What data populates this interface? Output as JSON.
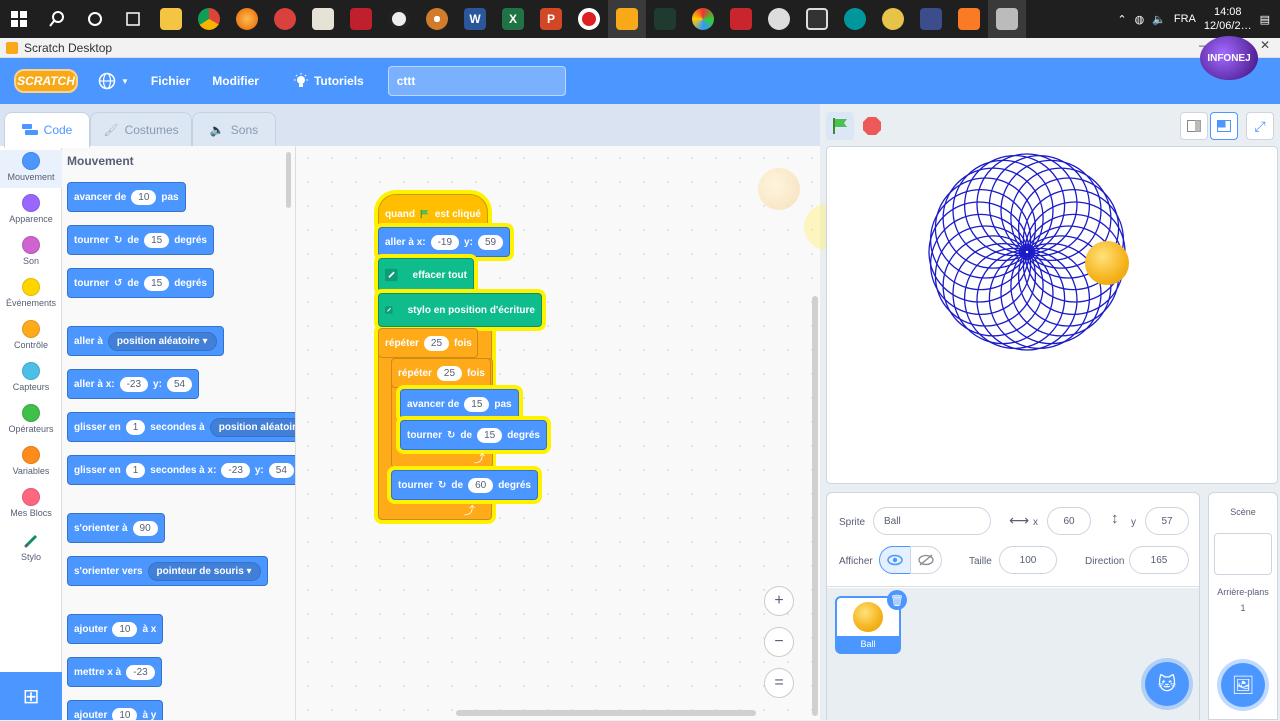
{
  "taskbar": {
    "apps": [
      "windows-start",
      "search",
      "cortana",
      "task-view",
      "file-explorer",
      "chrome",
      "firefox",
      "app-red",
      "app-person",
      "app-download",
      "app-dark",
      "app-media",
      "word",
      "excel",
      "powerpoint",
      "record",
      "scratch",
      "pycharm",
      "app-color",
      "acrobat",
      "app-panda",
      "clapper",
      "arduino",
      "app-infinity",
      "app-dev",
      "xampp",
      "app-video"
    ],
    "lang": "FRA",
    "time": "14:08",
    "date": "12/06/2…"
  },
  "window": {
    "title": "Scratch Desktop",
    "badge": "INFONEJ"
  },
  "menubar": {
    "logo": "SCRATCH",
    "file": "Fichier",
    "edit": "Modifier",
    "tutorials": "Tutoriels",
    "project_title": "cttt"
  },
  "tabs": {
    "code": "Code",
    "costumes": "Costumes",
    "sounds": "Sons"
  },
  "categories": [
    {
      "label": "Mouvement",
      "color": "#4c97ff"
    },
    {
      "label": "Apparence",
      "color": "#9966ff"
    },
    {
      "label": "Son",
      "color": "#cf63cf"
    },
    {
      "label": "Événements",
      "color": "#ffd500"
    },
    {
      "label": "Contrôle",
      "color": "#ffab19"
    },
    {
      "label": "Capteurs",
      "color": "#4cbfe6"
    },
    {
      "label": "Opérateurs",
      "color": "#40bf4a"
    },
    {
      "label": "Variables",
      "color": "#ff8c1a"
    },
    {
      "label": "Mes Blocs",
      "color": "#ff6680"
    },
    {
      "label": "Stylo",
      "color": "#0fbd8c"
    }
  ],
  "palette": {
    "title": "Mouvement",
    "move": {
      "a": "avancer de",
      "v": "10",
      "b": "pas"
    },
    "turn_right": {
      "a": "tourner",
      "b": "de",
      "v": "15",
      "c": "degrés"
    },
    "turn_left": {
      "a": "tourner",
      "b": "de",
      "v": "15",
      "c": "degrés"
    },
    "goto": {
      "a": "aller à",
      "d": "position aléatoire"
    },
    "goto_xy": {
      "a": "aller à x:",
      "x": "-23",
      "b": "y:",
      "y": "54"
    },
    "glide": {
      "a": "glisser en",
      "v": "1",
      "b": "secondes à",
      "d": "position aléatoire"
    },
    "glide_xy": {
      "a": "glisser en",
      "v": "1",
      "b": "secondes à x:",
      "x": "-23",
      "c": "y:",
      "y": "54"
    },
    "point_dir": {
      "a": "s'orienter à",
      "v": "90"
    },
    "point_towards": {
      "a": "s'orienter vers",
      "d": "pointeur de souris"
    },
    "change_x": {
      "a": "ajouter",
      "v": "10",
      "b": "à x"
    },
    "set_x": {
      "a": "mettre x à",
      "v": "-23"
    },
    "change_y": {
      "a": "ajouter",
      "v": "10",
      "b": "à y"
    }
  },
  "script": {
    "hat": {
      "a": "quand",
      "b": "est cliqué"
    },
    "goto": {
      "a": "aller à x:",
      "x": "-19",
      "b": "y:",
      "y": "59"
    },
    "clear": "effacer tout",
    "pen_down": "stylo en position d'écriture",
    "repeat_outer": {
      "a": "répéter",
      "v": "25",
      "b": "fois"
    },
    "repeat_inner": {
      "a": "répéter",
      "v": "25",
      "b": "fois"
    },
    "move": {
      "a": "avancer de",
      "v": "15",
      "b": "pas"
    },
    "turn_inner": {
      "a": "tourner",
      "b": "de",
      "v": "15",
      "c": "degrés"
    },
    "turn_outer": {
      "a": "tourner",
      "b": "de",
      "v": "60",
      "c": "degrés"
    }
  },
  "zoom": {
    "in": "+",
    "out": "−",
    "reset": "="
  },
  "sprite_info": {
    "sprite_label": "Sprite",
    "sprite_name": "Ball",
    "x_label": "x",
    "x_value": "60",
    "y_label": "y",
    "y_value": "57",
    "show_label": "Afficher",
    "size_label": "Taille",
    "size_value": "100",
    "direction_label": "Direction",
    "direction_value": "165"
  },
  "sprites": [
    {
      "name": "Ball"
    }
  ],
  "stage_panel": {
    "title": "Scène",
    "backdrops_label": "Arrière-plans",
    "backdrops_count": "1"
  },
  "colors": {
    "scratch_blue": "#4c97ff",
    "pen_blue": "#1b1bc8",
    "motion": "#4c97ff",
    "events": "#ffbf00",
    "control": "#ffab19",
    "pen": "#0fbd8c"
  }
}
